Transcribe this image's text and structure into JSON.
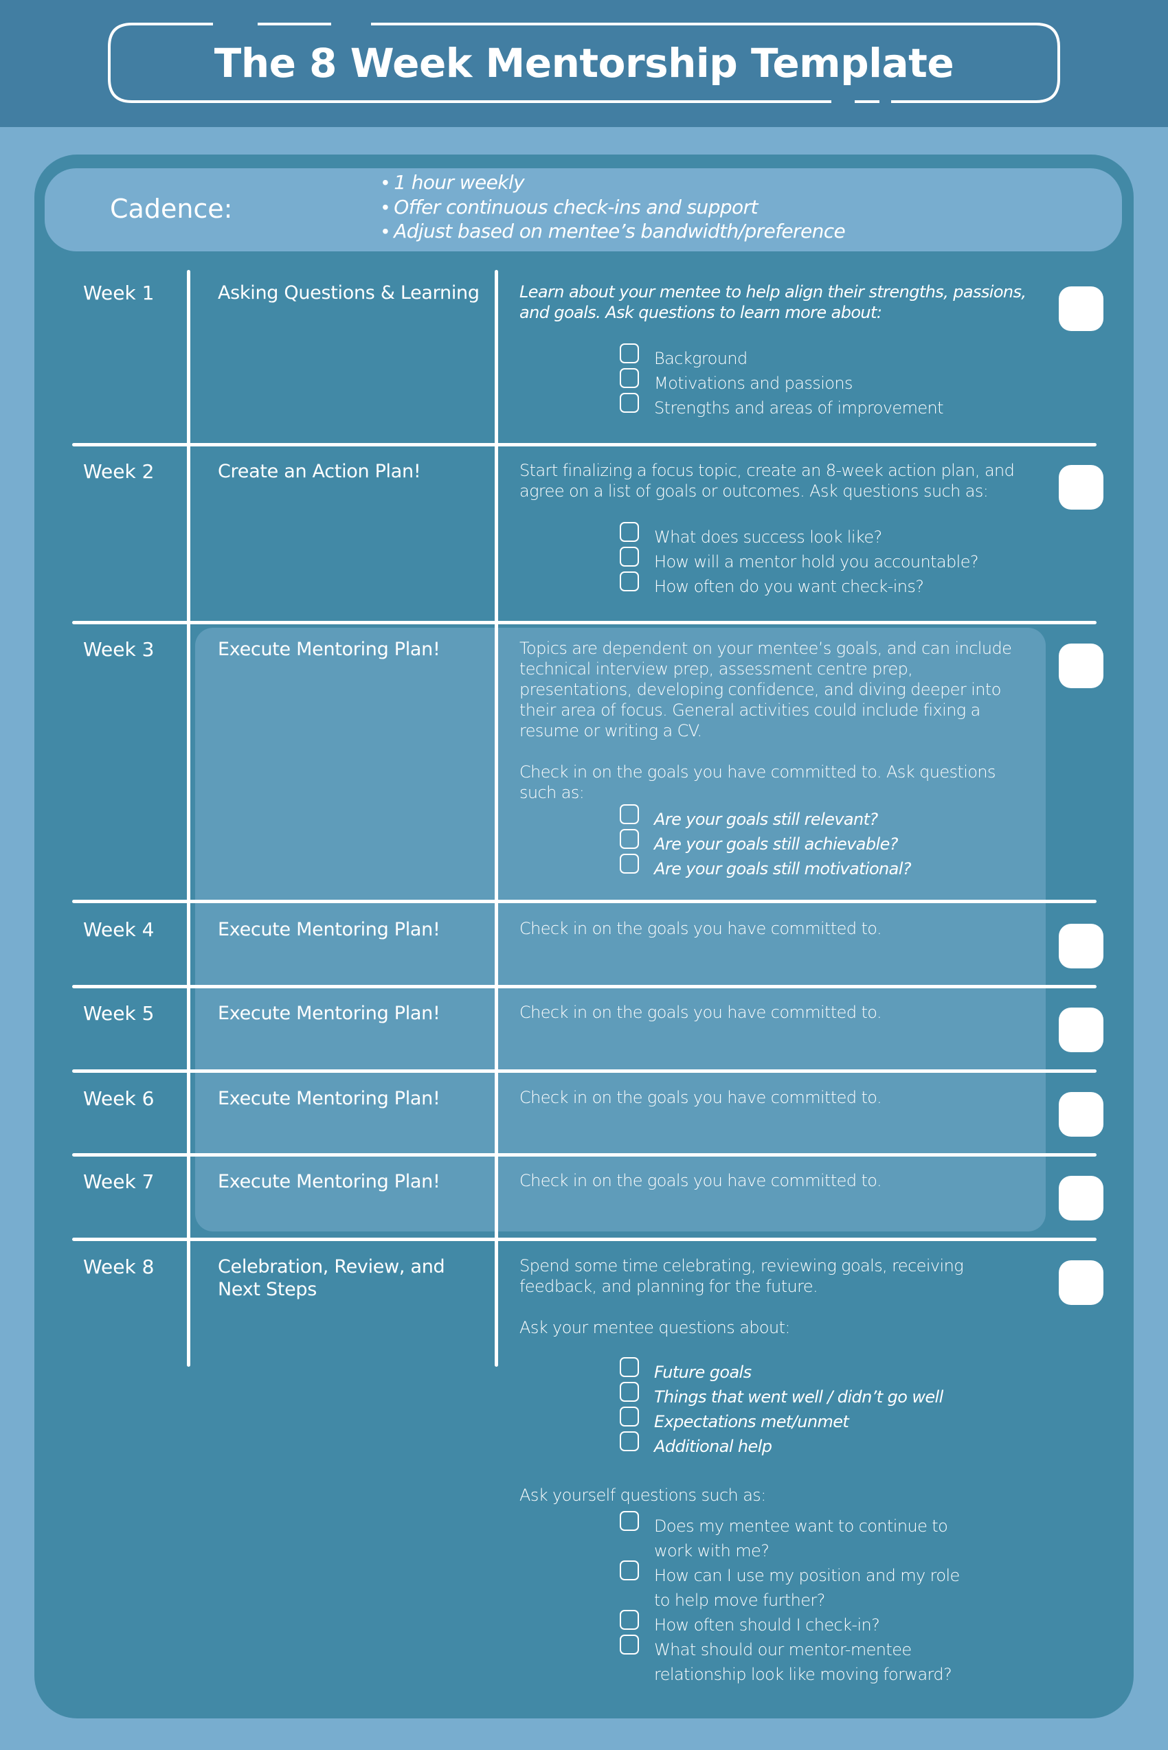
{
  "header": {
    "title": "The 8 Week Mentorship Template"
  },
  "colors": {
    "header_band": "#427ea2",
    "page_background": "#78adcf",
    "card_background": "#4289a6",
    "highlight_panel": "#5f9cba",
    "text": "#ffffff"
  },
  "cadence": {
    "label": "Cadence:",
    "items": [
      "1 hour weekly",
      "Offer continuous check-ins and support",
      "Adjust based on mentee’s bandwidth/preference"
    ]
  },
  "weeks": [
    {
      "label": "Week 1",
      "title": "Asking Questions & Learning",
      "intro": "Learn about your mentee to help align their strengths, passions, and goals. Ask questions to learn more about:",
      "checklist": [
        "Background",
        "Motivations and passions",
        "Strengths and areas of improvement"
      ]
    },
    {
      "label": "Week 2",
      "title": "Create an Action Plan!",
      "intro": "Start finalizing a focus topic, create an 8-week action plan, and agree on a list of goals or outcomes. Ask questions such as:",
      "checklist": [
        "What does success look like?",
        "How will a mentor hold you accountable?",
        "How often do you want check-ins?"
      ]
    },
    {
      "label": "Week 3",
      "title": "Execute Mentoring Plan!",
      "intro": "Topics are dependent on your mentee’s goals, and can include technical interview prep, assessment centre prep, presentations, developing confidence, and diving deeper into their area of focus. General activities could include fixing a resume or writing a CV.",
      "intro2": "Check in on the goals you have committed to. Ask questions such as:",
      "checklist": [
        "Are your goals still relevant?",
        "Are your goals still achievable?",
        "Are your goals still motivational?"
      ]
    },
    {
      "label": "Week 4",
      "title": "Execute Mentoring Plan!",
      "intro": "Check in on the goals you have committed to."
    },
    {
      "label": "Week 5",
      "title": "Execute Mentoring Plan!",
      "intro": "Check in on the goals you have committed to."
    },
    {
      "label": "Week 6",
      "title": "Execute Mentoring Plan!",
      "intro": "Check in on the goals you have committed to."
    },
    {
      "label": "Week 7",
      "title": "Execute Mentoring Plan!",
      "intro": "Check in on the goals you have committed to."
    },
    {
      "label": "Week 8",
      "title": "Celebration, Review, and Next Steps",
      "intro": "Spend some time celebrating, reviewing goals, receiving feedback, and planning for the future.",
      "mentee_heading": "Ask your mentee questions about:",
      "mentee_checklist": [
        "Future goals",
        "Things that went well / didn’t go well",
        "Expectations met/unmet",
        "Additional help"
      ],
      "self_heading": "Ask yourself questions such as:",
      "self_checklist": [
        "Does my mentee want to continue to work with me?",
        "How can I use my position and my role to help move further?",
        "How often should I check-in?",
        "What should our mentor-mentee relationship look like moving forward?"
      ]
    }
  ]
}
